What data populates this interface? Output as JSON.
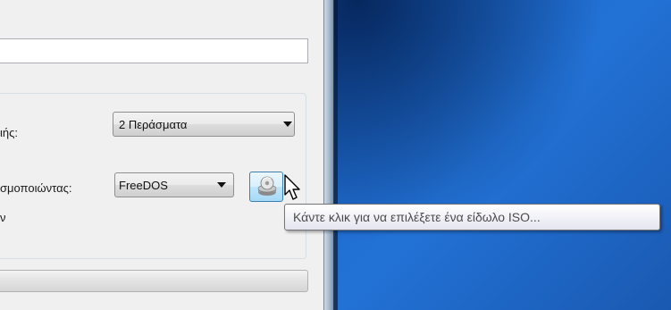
{
  "dialog": {
    "text_field_value": "",
    "row1": {
      "label": "ιής:",
      "select_value": "2 Περάσματα"
    },
    "row2": {
      "label": "σμοποιώντας:",
      "select_value": "FreeDOS",
      "extra_char": "ν"
    },
    "iso_button_icon": "disc-drive-icon"
  },
  "tooltip": {
    "text": "Κάντε κλικ για να επιλέξετε ένα είδωλο ISO..."
  }
}
